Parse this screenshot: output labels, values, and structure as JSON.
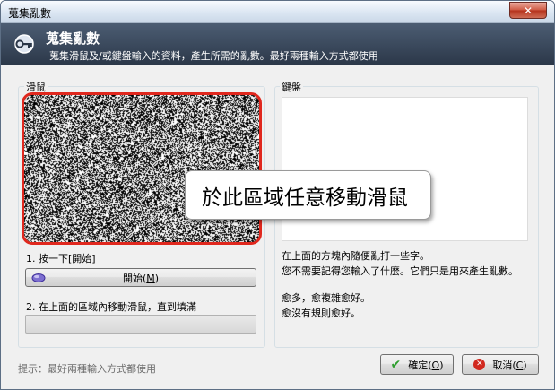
{
  "window": {
    "title": "蒐集亂數",
    "close_glyph": "✕"
  },
  "header": {
    "title": "蒐集亂數",
    "description": "蒐集滑鼠及/或鍵盤輸入的資料，產生所需的亂數。最好兩種輸入方式都使用",
    "icon": "key-icon"
  },
  "mouse_group": {
    "label": "滑鼠",
    "step1_label": "1. 按一下[開始]",
    "start_button": {
      "text": "開始",
      "accel_open": "(",
      "accel": "M",
      "accel_close": ")"
    },
    "step2_label": "2. 在上面的區域內移動滑鼠，直到填滿",
    "progress": 0,
    "highlight_color": "#e0281e"
  },
  "keyboard_group": {
    "label": "鍵盤",
    "info_lines": [
      "在上面的方塊內隨便亂打一些字。",
      "您不需要記得您輸入了什麼。它們只是用來產生亂數。",
      "愈多，愈複雜愈好。",
      "愈沒有規則愈好。"
    ]
  },
  "callout": {
    "text": "於此區域任意移動滑鼠"
  },
  "footer": {
    "hint": "提示：最好兩種輸入方式都使用",
    "ok_button": {
      "text": "確定",
      "accel_open": "(",
      "accel": "O",
      "accel_close": ")",
      "icon": "checkmark-icon"
    },
    "cancel_button": {
      "text": "取消",
      "accel_open": "(",
      "accel": "C",
      "accel_close": ")",
      "icon": "cancel-icon"
    }
  },
  "colors": {
    "header_bg": "#2b3748",
    "ok_icon": "#2e9e2e",
    "cancel_icon": "#d1281e"
  }
}
